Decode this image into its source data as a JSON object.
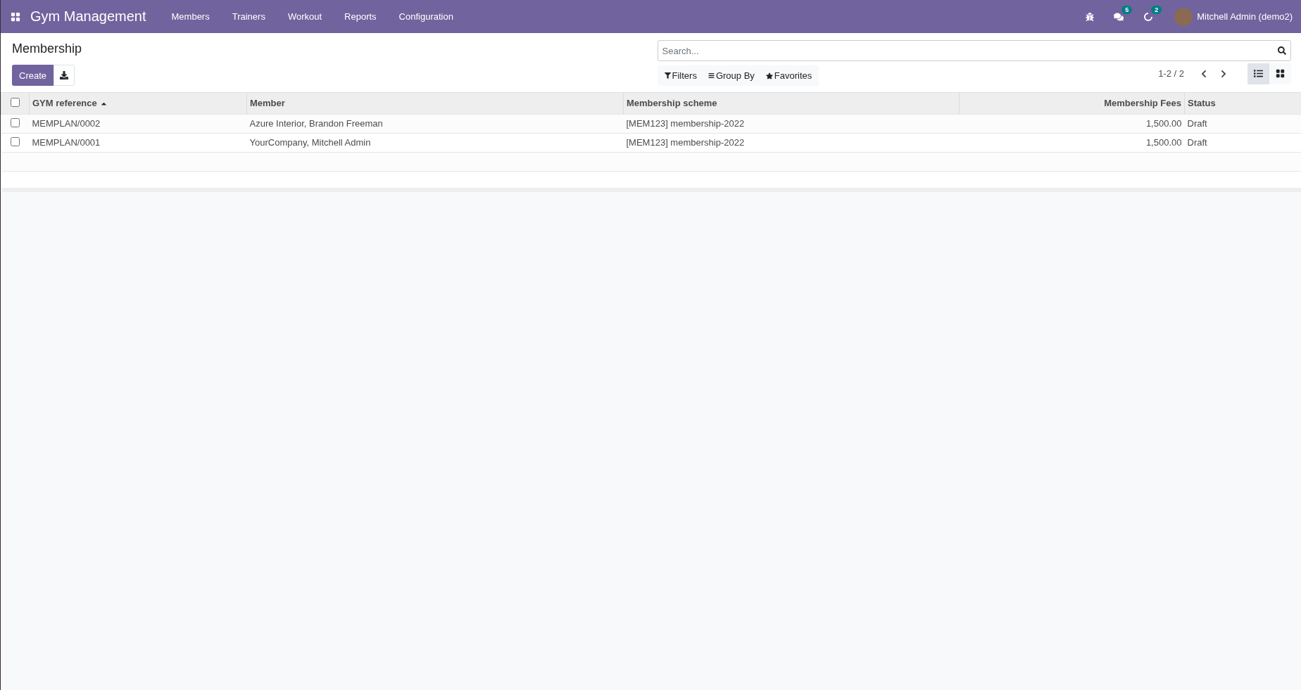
{
  "navbar": {
    "app_name": "Gym Management",
    "menu": [
      "Members",
      "Trainers",
      "Workout",
      "Reports",
      "Configuration"
    ],
    "messages_badge": "5",
    "activities_badge": "2",
    "user": "Mitchell Admin (demo2)"
  },
  "page_title": "Membership",
  "buttons": {
    "create": "Create"
  },
  "search": {
    "placeholder": "Search..."
  },
  "filters": [
    "Filters",
    "Group By",
    "Favorites"
  ],
  "pager": "1-2 / 2",
  "views": [
    {
      "kind": "list",
      "selected": true
    },
    {
      "kind": "kanban",
      "selected": false
    }
  ],
  "table": {
    "select_all": {
      "checked": false
    },
    "columns": [
      {
        "label": "GYM reference",
        "sorted": true,
        "kind": "text"
      },
      {
        "label": "Member",
        "sorted": false,
        "kind": "text"
      },
      {
        "label": "Membership scheme",
        "sorted": false,
        "kind": "text"
      },
      {
        "label": "Membership Fees",
        "sorted": false,
        "kind": "number"
      },
      {
        "label": "Status",
        "sorted": false,
        "kind": "text"
      }
    ],
    "rows": [
      {
        "checked": false,
        "cells": [
          "MEMPLAN/0002",
          "Azure Interior, Brandon Freeman",
          "[MEM123] membership-2022",
          "1,500.00",
          "Draft"
        ]
      },
      {
        "checked": false,
        "cells": [
          "MEMPLAN/0001",
          "YourCompany, Mitchell Admin",
          "[MEM123] membership-2022",
          "1,500.00",
          "Draft"
        ]
      }
    ]
  }
}
